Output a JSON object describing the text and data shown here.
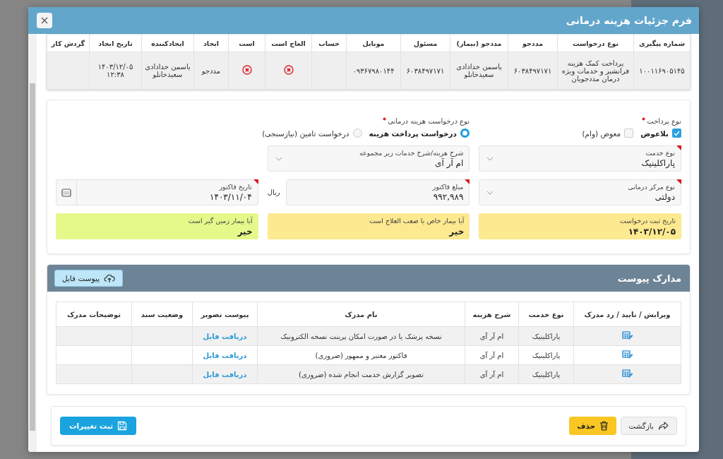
{
  "dialog": {
    "title": "فرم جزئیات هزینه درمانی"
  },
  "summary_table": {
    "columns": [
      "شماره پیگیری",
      "نوع درخواست",
      "مددجو",
      "مددجو (بیمار)",
      "مسئول",
      "موبایل",
      "حساب",
      "العاج است",
      "است",
      "ایجاد",
      "ایجادکننده",
      "تاریخ ایجاد",
      "گردش کار"
    ],
    "rows": [
      {
        "tracking_no": "۱۰۰۱۱۶۹۰۵۱۴۵",
        "request_type": "پرداخت کمک هزینه فرانشیز و خدمات ویژه درمان مددجویان",
        "client_code": "۶۰۳۸۴۹۷۱۷۱",
        "patient": "یاسمن خدادادی سعیدخانلو",
        "responsible": "۶۰۳۸۴۹۷۱۷۱",
        "mobile": "۰۹۳۶۷۹۸۰۱۴۴",
        "incurable": false,
        "flag": false,
        "created_as": "مددجو",
        "creator": "یاسمن خدادادی سعیدخانلو",
        "created_at": "۱۴۰۳/۱۲/۰۵ ۱۲:۳۸"
      }
    ]
  },
  "form": {
    "payment_type": {
      "label": "نوع پرداخت",
      "required": true,
      "options": [
        {
          "label": "بلاعوض",
          "checked": true
        },
        {
          "label": "معوض (وام)",
          "checked": false
        }
      ]
    },
    "request_type": {
      "label": "نوع درخواست هزینه درمانی",
      "required": true,
      "options": [
        {
          "label": "درخواست پرداخت هزینه",
          "selected": true
        },
        {
          "label": "درخواست تامین (نیازسنجی)",
          "selected": false
        }
      ]
    },
    "field_rows": [
      [
        {
          "kind": "select",
          "label": "نوع خدمت",
          "value": "پاراکلینیک",
          "required": true
        },
        {
          "kind": "select",
          "label": "شرح هزینه/شرح خدمات زیر مجموعه",
          "value": "ام آر آی",
          "required": false
        }
      ],
      [
        {
          "kind": "select",
          "label": "نوع مرکز درمانی",
          "value": "دولتی",
          "required": true
        },
        {
          "kind": "amount",
          "label": "مبلغ فاکتور",
          "value": "۹۹۲,۹۸۹",
          "suffix": "ریال",
          "required": true
        },
        {
          "kind": "date",
          "label": "تاریخ فاکتور",
          "value": "۱۴۰۳/۱۱/۰۴",
          "required": true
        }
      ],
      [
        {
          "kind": "info",
          "label": "تاریخ ثبت درخواست",
          "value": "۱۴۰۳/۱۲/۰۵",
          "color": "#fde98f"
        },
        {
          "kind": "info",
          "label": "آیا بیمار خاص یا صعب العلاج است",
          "value": "خیر",
          "color": "#fde98f"
        },
        {
          "kind": "info",
          "label": "آیا بیمار زمین گیر است",
          "value": "خیر",
          "color": "#e5f98b"
        }
      ]
    ]
  },
  "documents": {
    "title": "مدارک پیوست",
    "upload_button": "پیوست فایل",
    "columns": [
      "ویرایش / تایید / رد مدرک",
      "نوع خدمت",
      "شرح هزینه",
      "نام مدرک",
      "پیوست تصویر",
      "وضعیت سند",
      "توضیحات مدرک"
    ],
    "rows": [
      {
        "service": "پاراکلینیک",
        "cost": "ام آر آی",
        "name": "نسخه پزشک یا در صورت امکان پرینت نسخه الکترونیک",
        "link": "دریافت فایل"
      },
      {
        "service": "پاراکلینیک",
        "cost": "ام آر آی",
        "name": "فاکتور معتبر و ممهور (ضروری)",
        "link": "دریافت فایل"
      },
      {
        "service": "پاراکلینیک",
        "cost": "ام آر آی",
        "name": "تصویر گزارش خدمت انجام شده (ضروری)",
        "link": "دریافت فایل"
      }
    ]
  },
  "footer": {
    "buttons": [
      {
        "kind": "back",
        "label": "بازگشت"
      },
      {
        "kind": "delete",
        "label": "حذف"
      },
      {
        "kind": "save",
        "label": "ثبت تغییرات"
      }
    ]
  }
}
